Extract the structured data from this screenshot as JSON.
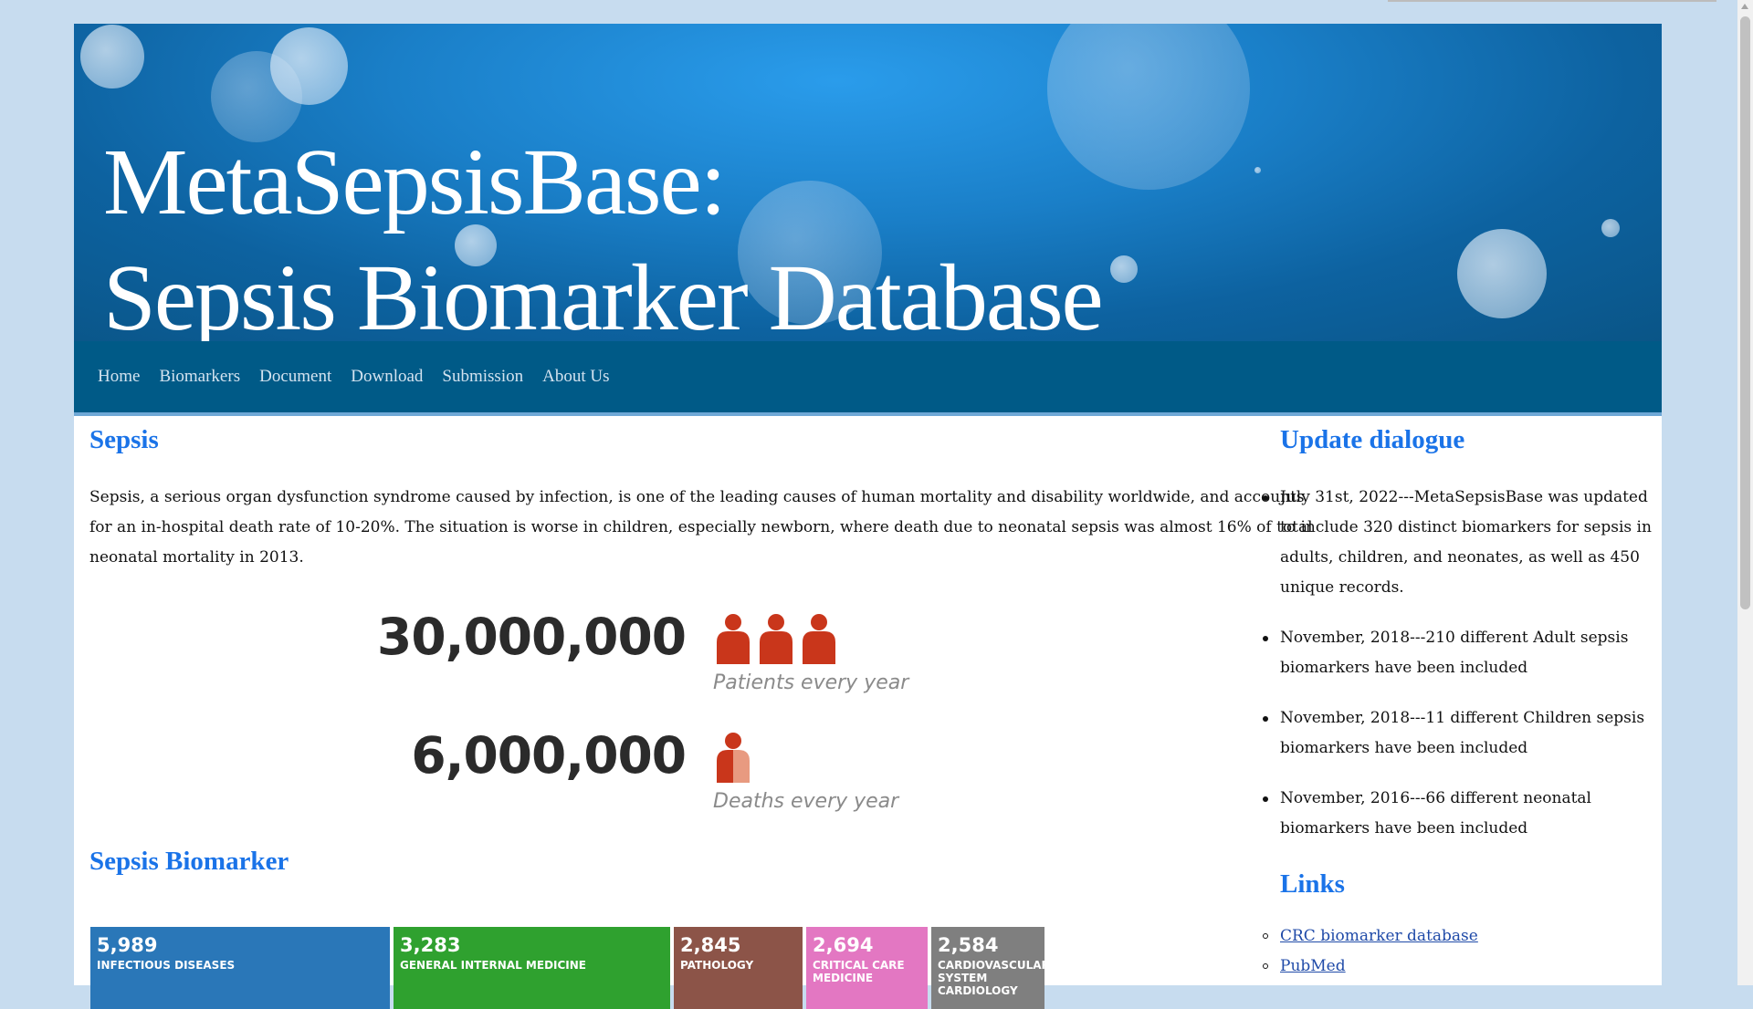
{
  "banner": {
    "title_line1": "MetaSepsisBase:",
    "title_line2": "Sepsis Biomarker Database"
  },
  "nav": {
    "items": [
      "Home",
      "Biomarkers",
      "Document",
      "Download",
      "Submission",
      "About Us"
    ]
  },
  "main": {
    "sepsis_heading": "Sepsis",
    "intro": "Sepsis, a serious organ dysfunction syndrome caused by infection, is one of the leading causes of human mortality and disability worldwide, and accounts for an in-hospital death rate of 10-20%. The situation is worse in children, especially newborn, where death due to neonatal sepsis was almost 16% of total neonatal mortality in 2013.",
    "stats": [
      {
        "value": "30,000,000",
        "caption": "Patients every year",
        "icon": "three-people-icon"
      },
      {
        "value": "6,000,000",
        "caption": "Deaths every year",
        "icon": "half-person-icon"
      }
    ],
    "biomarker_heading": "Sepsis Biomarker",
    "treemap": [
      {
        "value": "5,989",
        "name": "INFECTIOUS DISEASES",
        "color": "#2a77b8"
      },
      {
        "value": "3,283",
        "name": "GENERAL INTERNAL MEDICINE",
        "color": "#2fa12f"
      },
      {
        "value": "2,845",
        "name": "PATHOLOGY",
        "color": "#8c5448"
      },
      {
        "value": "2,694",
        "name": "CRITICAL CARE MEDICINE",
        "color": "#e377c2"
      },
      {
        "value": "2,584",
        "name": "CARDIOVASCULAR SYSTEM CARDIOLOGY",
        "color": "#7f7f7f"
      }
    ]
  },
  "side": {
    "update_heading": "Update dialogue",
    "updates": [
      "July 31st, 2022---MetaSepsisBase was updated to include 320 distinct biomarkers for sepsis in adults, children, and neonates, as well as 450 unique records.",
      "November, 2018---210 different Adult sepsis biomarkers have been included",
      "November, 2018---11 different Children sepsis biomarkers have been included",
      "November, 2016---66 different neonatal biomarkers have been included"
    ],
    "links_heading": "Links",
    "links": [
      "CRC biomarker database",
      "PubMed"
    ]
  },
  "colors": {
    "heading": "#1a73e8",
    "navbar": "#005a87",
    "person_dark": "#c9361b",
    "person_light": "#e89a80"
  }
}
